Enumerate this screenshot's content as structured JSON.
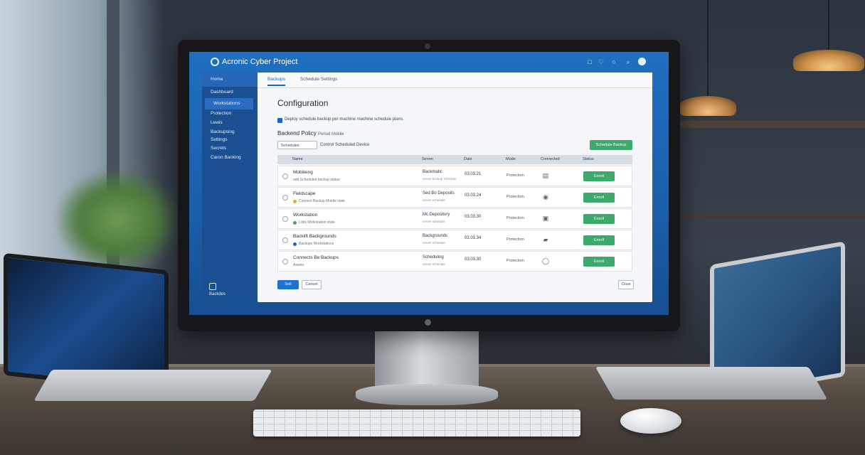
{
  "app": {
    "title": "Acronic Cyber Project"
  },
  "header_icons": [
    "notification-icon",
    "bell-icon",
    "globe-icon",
    "search-icon",
    "avatar"
  ],
  "sidebar": {
    "items": [
      {
        "label": "Home"
      },
      {
        "label": "Dashboard"
      },
      {
        "label": "Workstations"
      },
      {
        "label": "Protection"
      },
      {
        "label": "Lewis"
      },
      {
        "label": "Backupsing"
      },
      {
        "label": "Settings"
      },
      {
        "label": "Secrets"
      },
      {
        "label": "Caron Backing"
      }
    ],
    "footer_label": "Backdes"
  },
  "tabs": [
    {
      "label": "Backups"
    },
    {
      "label": "Schedule Settings"
    }
  ],
  "page": {
    "title": "Configuration",
    "checkbox_label": "Deploy schedule backup per machine machine schedule plans.",
    "section_title": "Backend Policy",
    "section_subtitle": "Period Mobile",
    "filter_select": "Schedules",
    "filter_label": "Control Scheduled Device",
    "primary_action": "Schedule Backup"
  },
  "table": {
    "headers": [
      "Name",
      "Server",
      "Date",
      "Mode",
      "Connected",
      "Status"
    ],
    "rows": [
      {
        "name": "Mobileing",
        "sub": "add Scheduled backup status",
        "server": "Backmatic",
        "server_sub": "server backup schedule",
        "date": "03.03.21",
        "mode": "Protection",
        "connected_icon": "server-icon",
        "action": "Enroll"
      },
      {
        "name": "Fieldscape",
        "sub": "Connect Backup Mobile state",
        "server": "Sed Bo Deposits",
        "server_sub": "server schedule",
        "date": "03.03.24",
        "mode": "Protection",
        "connected_icon": "drive-icon",
        "action": "Enroll"
      },
      {
        "name": "Workstation",
        "sub": "Lobs Workstation state",
        "server": "Mc Depository",
        "server_sub": "server schedule",
        "date": "03.03.30",
        "mode": "Protection",
        "connected_icon": "disk-icon",
        "action": "Enroll"
      },
      {
        "name": "Backlift Backgrounds",
        "sub": "Backups Workstations",
        "server": "Backgrounds",
        "server_sub": "server schedule",
        "date": "03.03.34",
        "mode": "Protection",
        "connected_icon": "shield-icon",
        "action": "Enroll"
      },
      {
        "name": "Connects Be Backups",
        "sub": "Assets",
        "server": "Scheduling",
        "server_sub": "server schedule",
        "date": "03.03.30",
        "mode": "Protection",
        "connected_icon": "lock-icon",
        "action": "Enroll"
      }
    ]
  },
  "footer_buttons": {
    "save": "Sell",
    "cancel": "Cancel",
    "close": "Close"
  },
  "colors": {
    "brand_blue": "#1e63b7",
    "sidebar_bg": "#1a4f92",
    "success_green": "#3da96c"
  }
}
